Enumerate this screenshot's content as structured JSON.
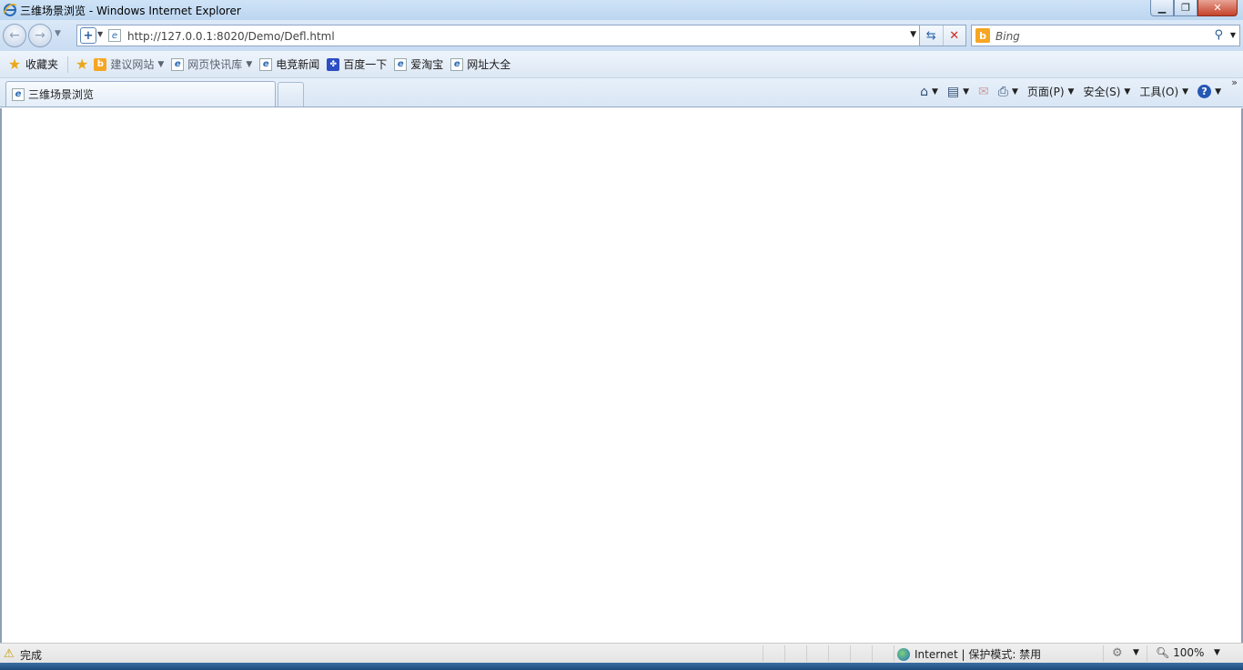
{
  "window": {
    "title": "三维场景浏览 - Windows Internet Explorer"
  },
  "nav": {
    "url": "http://127.0.0.1:8020/Demo/Defl.html",
    "search_placeholder": "Bing"
  },
  "favorites": {
    "favorites_label": "收藏夹",
    "items": [
      {
        "label": "建议网站",
        "icon": "bing-icon",
        "dropdown": true
      },
      {
        "label": "网页快讯库",
        "icon": "ie-page-icon",
        "dropdown": true
      },
      {
        "label": "电竞新闻",
        "icon": "ie-page-icon"
      },
      {
        "label": "百度一下",
        "icon": "baidu-paw-icon"
      },
      {
        "label": "爱淘宝",
        "icon": "ie-page-icon"
      },
      {
        "label": "网址大全",
        "icon": "ie-page-icon"
      }
    ]
  },
  "tabs": [
    {
      "label": "三维场景浏览",
      "active": true
    }
  ],
  "commandbar": {
    "page_label": "页面(P)",
    "safety_label": "安全(S)",
    "tools_label": "工具(O)"
  },
  "status": {
    "text": "完成",
    "zone": "Internet | 保护模式: 禁用",
    "zoom": "100%"
  },
  "colors": {
    "accent": "#2a6bb6",
    "stop": "#d02a1f",
    "bing": "#f5a623"
  }
}
